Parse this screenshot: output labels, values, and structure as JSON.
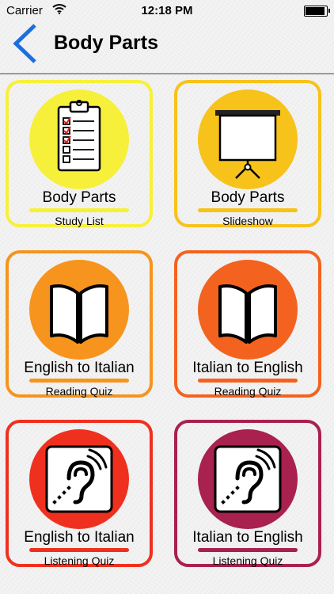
{
  "status_bar": {
    "carrier": "Carrier",
    "time": "12:18 PM"
  },
  "nav": {
    "title": "Body Parts"
  },
  "colors": {
    "back_arrow": "#1a6fe0",
    "divider": "#9b9b9b",
    "yellow": "#f7f03a",
    "yellow_orange": "#f7c21a",
    "orange": "#f6941e",
    "orange_red": "#f4621f",
    "red": "#f0301f",
    "maroon": "#a8214f"
  },
  "tiles": [
    {
      "title": "Body Parts",
      "subtitle": "Study List",
      "icon": "clipboard-icon",
      "color": "#f7f03a"
    },
    {
      "title": "Body Parts",
      "subtitle": "Slideshow",
      "icon": "projector-screen-icon",
      "color": "#f7c21a"
    },
    {
      "title": "English to Italian",
      "subtitle": "Reading Quiz",
      "icon": "open-book-icon",
      "color": "#f6941e"
    },
    {
      "title": "Italian to English",
      "subtitle": "Reading Quiz",
      "icon": "open-book-icon",
      "color": "#f4621f"
    },
    {
      "title": "English to Italian",
      "subtitle": "Listening Quiz",
      "icon": "hearing-ear-icon",
      "color": "#f0301f"
    },
    {
      "title": "Italian to English",
      "subtitle": "Listening Quiz",
      "icon": "hearing-ear-icon",
      "color": "#a8214f"
    }
  ]
}
